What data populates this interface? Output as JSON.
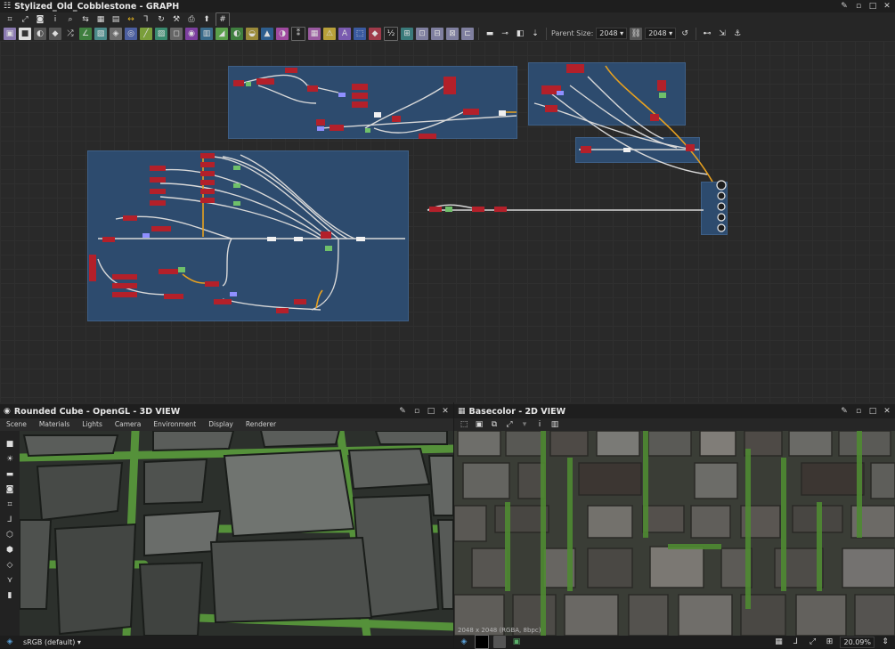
{
  "graph_window": {
    "title": "Stylized_Old_Cobblestone - GRAPH",
    "parent_size_label": "Parent Size:",
    "parent_size_value": "2048",
    "output_size_value": "2048"
  },
  "view3d": {
    "title": "Rounded Cube - OpenGL - 3D VIEW",
    "menu": [
      "Scene",
      "Materials",
      "Lights",
      "Camera",
      "Environment",
      "Display",
      "Renderer"
    ],
    "colorspace": "sRGB (default)"
  },
  "view2d": {
    "title": "Basecolor - 2D VIEW",
    "info": "2048 x 2048 (RGBA, 8bpc)",
    "zoom": "20.09%"
  },
  "colors": {
    "frame": "#2d4b6e",
    "node_red": "#b3202a",
    "wire": "#d9d9d9",
    "wire_orange": "#e8a11f"
  }
}
